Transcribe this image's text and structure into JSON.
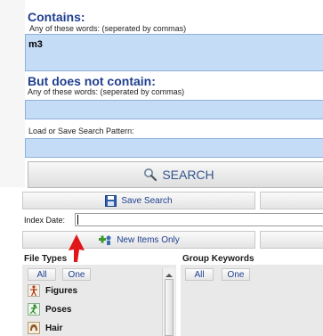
{
  "contains": {
    "title": "Contains:",
    "hint": "Any of these words:  (seperated by commas)",
    "value": "m3"
  },
  "not_contain": {
    "title": "But does not contain:",
    "hint": "Any of these words:  (seperated by commas)",
    "value": ""
  },
  "pattern": {
    "label": "Load or Save Search Pattern:",
    "value": ""
  },
  "search_button": {
    "label": "SEARCH",
    "icon": "magnifier-icon"
  },
  "save_search_button": {
    "label": "Save Search",
    "icon": "floppy-disk-icon"
  },
  "index_date": {
    "label": "Index Date:",
    "value": ""
  },
  "new_items_button": {
    "label": "New Items Only",
    "icon": "add-items-icon"
  },
  "file_types": {
    "title": "File Types",
    "all_label": "All",
    "one_label": "One",
    "items": [
      {
        "label": "Figures",
        "icon": "figure-icon"
      },
      {
        "label": "Poses",
        "icon": "pose-icon"
      },
      {
        "label": "Hair",
        "icon": "hair-icon"
      }
    ]
  },
  "group_keywords": {
    "title": "Group Keywords",
    "all_label": "All",
    "one_label": "One"
  },
  "colors": {
    "heading": "#1f3f8f",
    "field_bg": "#c5dcf7",
    "arrow": "#e0161b"
  }
}
